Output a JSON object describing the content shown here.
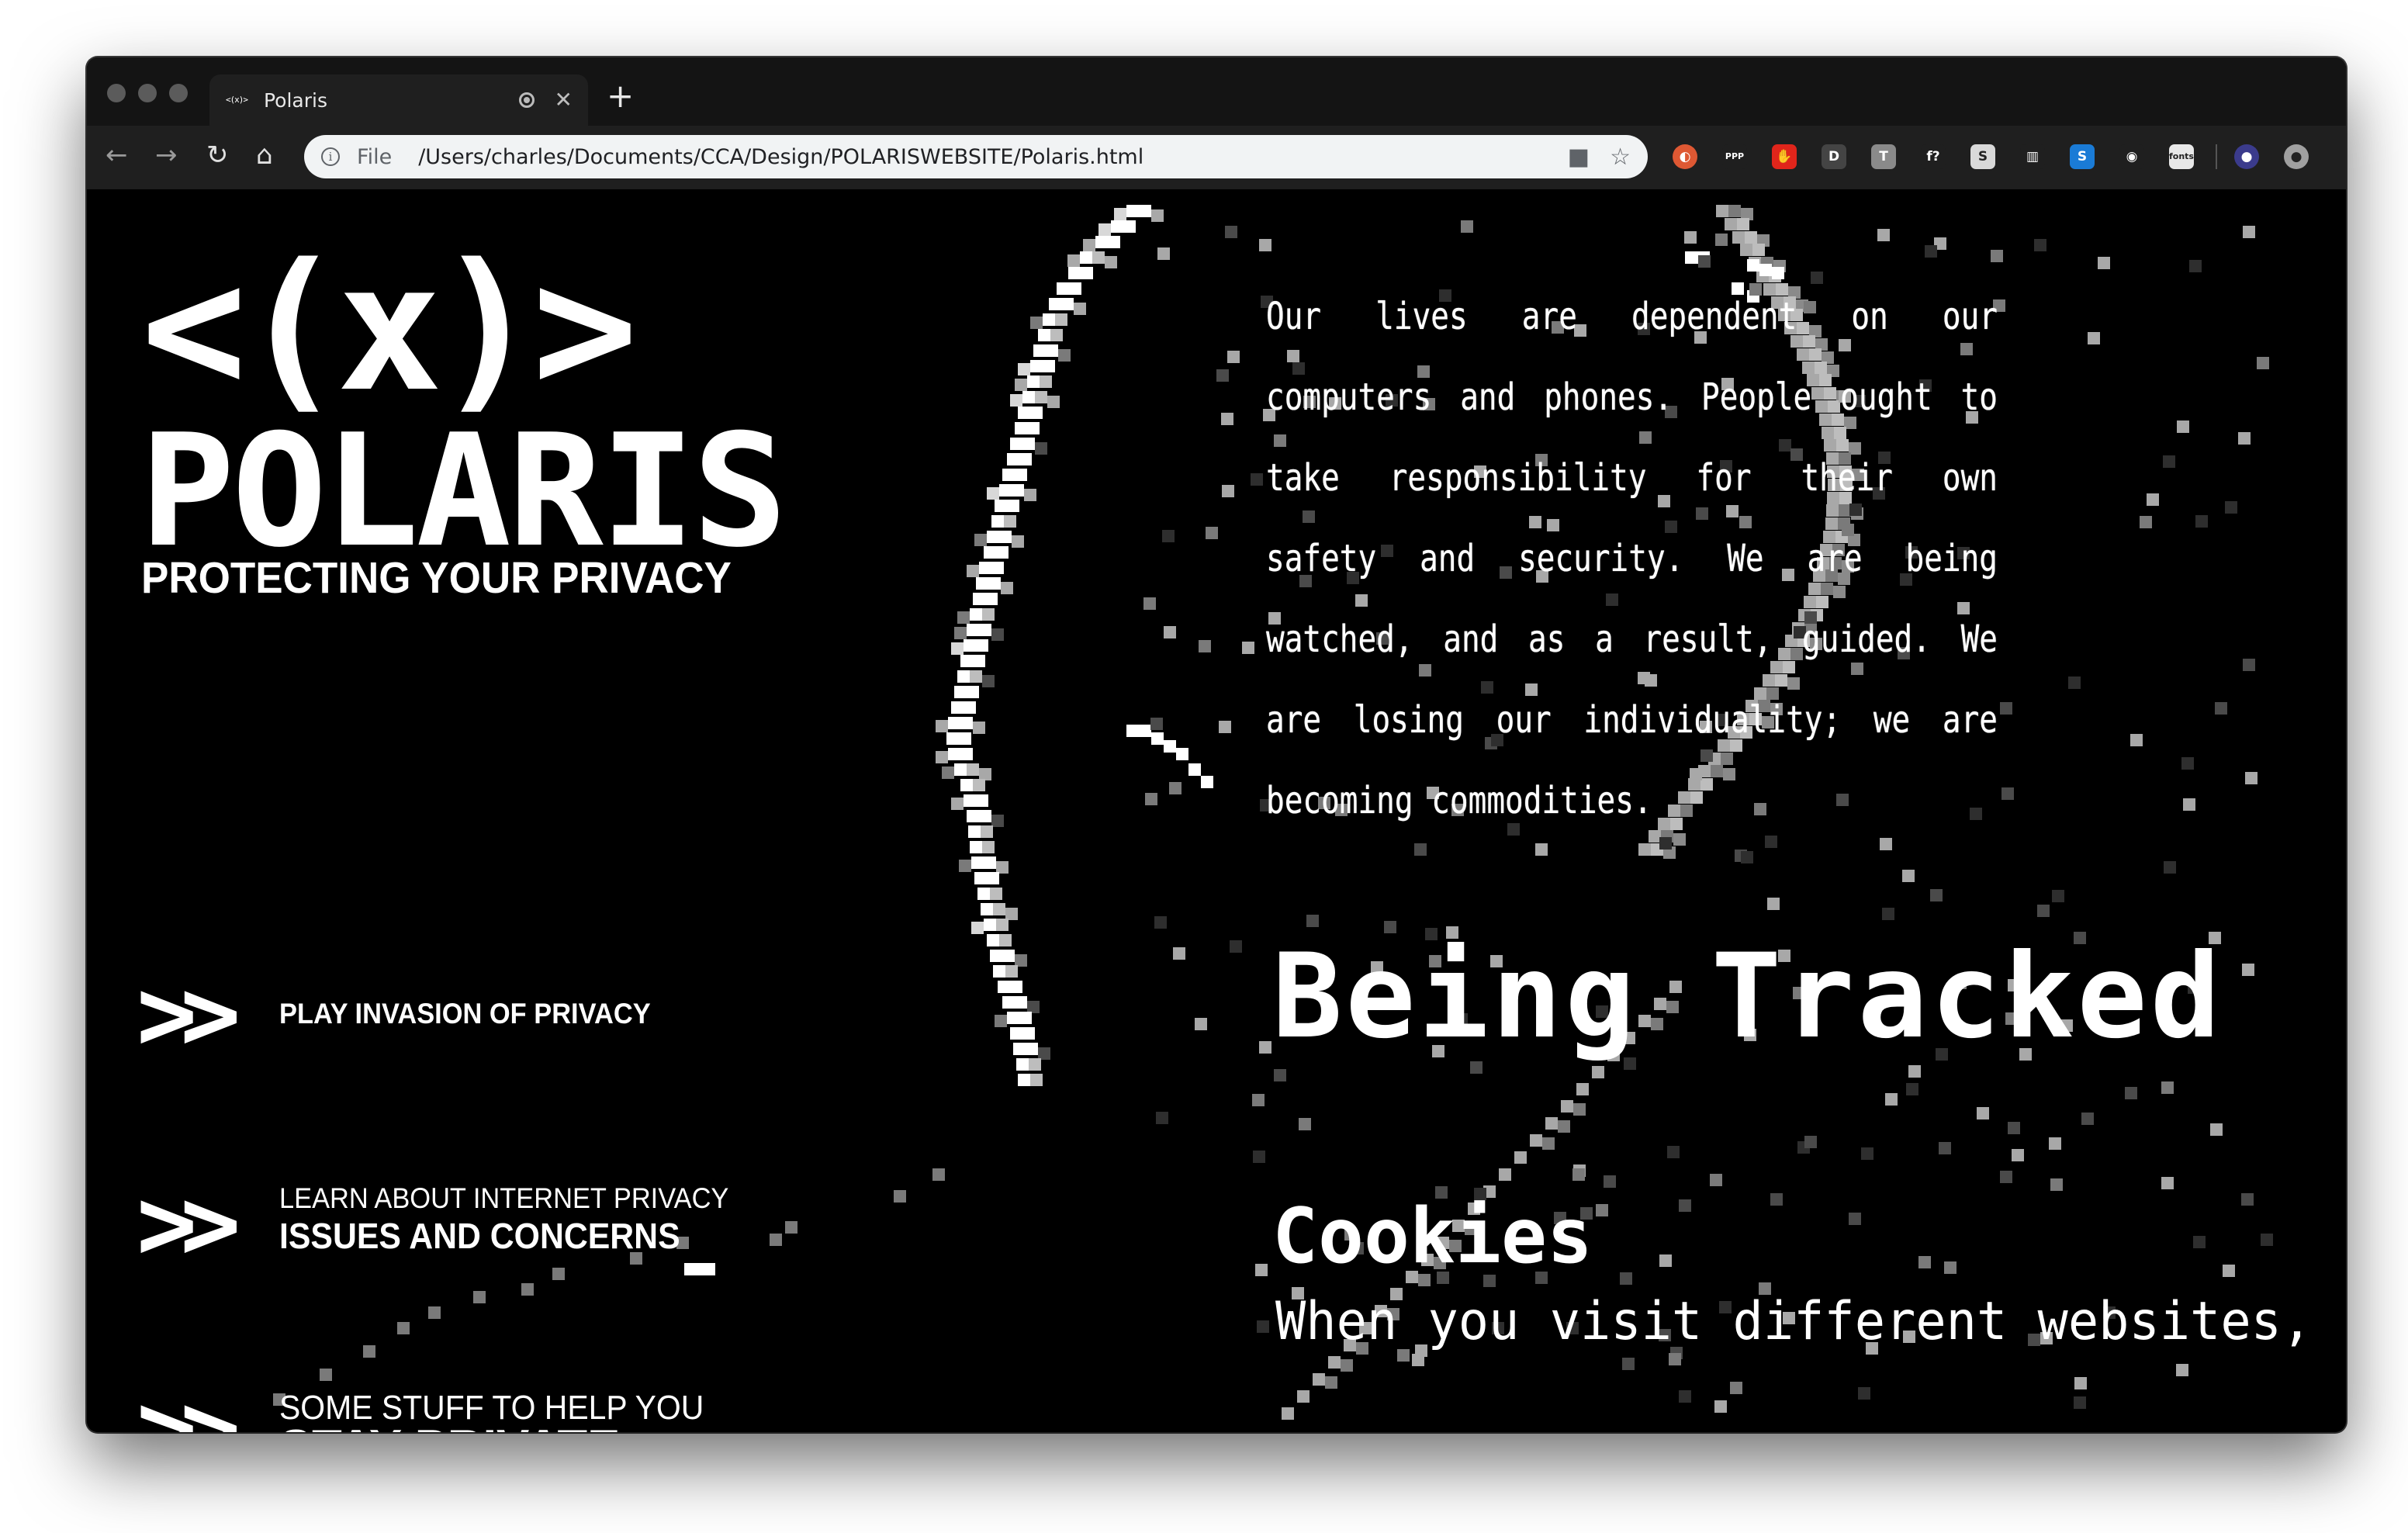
{
  "browser": {
    "tab": {
      "favicon_text": "<(x)>",
      "title": "Polaris"
    },
    "new_tab_label": "+",
    "nav": {
      "back": "←",
      "forward": "→",
      "reload": "↻",
      "home": "⌂"
    },
    "omnibox": {
      "scheme": "File",
      "url": "/Users/charles/Documents/CCA/Design/POLARISWEBSITE/Polaris.html"
    },
    "extensions": [
      {
        "name": "duckduckgo-icon",
        "glyph": "◐",
        "color": "#de5833"
      },
      {
        "name": "ppp-icon",
        "glyph": "PPP",
        "color": "#1f1f1f"
      },
      {
        "name": "hand-icon",
        "glyph": "✋",
        "color": "#e0251b"
      },
      {
        "name": "d-icon",
        "glyph": "D",
        "color": "#444444"
      },
      {
        "name": "t-icon",
        "glyph": "T",
        "color": "#8a8a8a"
      },
      {
        "name": "font-finder-icon",
        "glyph": "f?",
        "color": "#1f1f1f"
      },
      {
        "name": "s-icon",
        "glyph": "S",
        "color": "#d9d9d9"
      },
      {
        "name": "columns-icon",
        "glyph": "▥",
        "color": "#1f1f1f"
      },
      {
        "name": "s-blue-icon",
        "glyph": "S",
        "color": "#1a7bd6"
      },
      {
        "name": "lips-icon",
        "glyph": "◉",
        "color": "#1f1f1f"
      },
      {
        "name": "fonts-icon",
        "glyph": "fonts",
        "color": "#e8e8e8"
      },
      {
        "name": "profile-icon",
        "glyph": "●",
        "color": "#3b3b8c"
      },
      {
        "name": "update-icon",
        "glyph": "●",
        "color": "#a0a0a0"
      }
    ]
  },
  "site": {
    "logo_mark": "<(x)>",
    "logo_word": "POLARIS",
    "tagline": "PROTECTING YOUR PRIVACY",
    "nav_arrow": ">>",
    "nav": [
      {
        "line1": "PLAY INVASION OF PRIVACY",
        "line2": ""
      },
      {
        "line1": "LEARN ABOUT INTERNET PRIVACY",
        "line2": "ISSUES AND CONCERNS"
      },
      {
        "line1": "SOME STUFF TO HELP YOU",
        "line2": "STAY PRIVATE"
      }
    ],
    "intro": "Our lives are dependent on our computers and phones. People ought to take responsibility for their own safety and security. We are being watched, and as a result, guided. We are losing our individuality; we are becoming commodities.",
    "heading": "Being Tracked",
    "subheading": "Cookies",
    "body": "When you visit different websites,"
  }
}
